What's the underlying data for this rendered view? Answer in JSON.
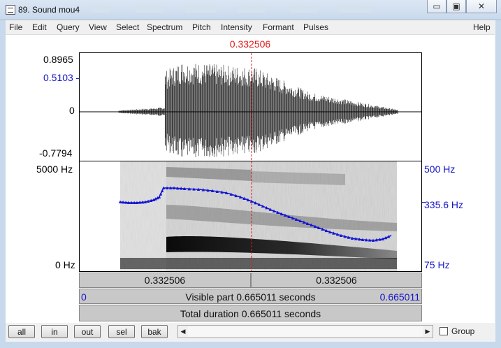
{
  "window": {
    "title": "89. Sound mou4",
    "minimize_glyph": "▭",
    "maximize_glyph": "▣",
    "close_glyph": "✕"
  },
  "menu": [
    "File",
    "Edit",
    "Query",
    "View",
    "Select",
    "Spectrum",
    "Pitch",
    "Intensity",
    "Formant",
    "Pulses"
  ],
  "help_label": "Help",
  "cursor_time": "0.332506",
  "waveform": {
    "max_label": "0.8965",
    "cursor_value_label": "0.5103",
    "zero_label": "0",
    "min_label": "-0.7794"
  },
  "spectrogram": {
    "top_freq_label": "5000 Hz",
    "bottom_freq_label": "0 Hz",
    "pitch_top_label": "500 Hz",
    "pitch_cursor_label": "335.6 Hz",
    "pitch_bottom_label": "75 Hz",
    "pitch_track_color": "#1414d2"
  },
  "time_bars": {
    "left_segment": "0.332506",
    "right_segment": "0.332506",
    "visible_start": "0",
    "visible_text": "Visible part 0.665011 seconds",
    "visible_end": "0.665011",
    "total_text": "Total duration 0.665011 seconds"
  },
  "buttons": [
    "all",
    "in",
    "out",
    "sel",
    "bak"
  ],
  "group_label": "Group",
  "scroll_left": "◀",
  "scroll_right": "▶",
  "colors": {
    "cursor": "#e21b1b",
    "axis_blue": "#1616c8"
  }
}
